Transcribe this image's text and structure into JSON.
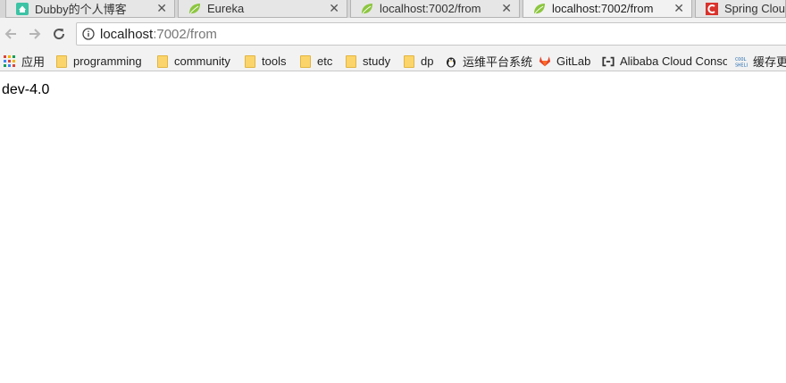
{
  "tabs": [
    {
      "title": "Dubby的个人博客",
      "icon": "house-icon",
      "active": false
    },
    {
      "title": "Eureka",
      "icon": "spring-leaf-icon",
      "active": false
    },
    {
      "title": "localhost:7002/from",
      "icon": "spring-leaf-icon",
      "active": false
    },
    {
      "title": "localhost:7002/from",
      "icon": "spring-leaf-icon",
      "active": true
    },
    {
      "title": "Spring Cloud",
      "icon": "c-logo-icon",
      "active": false
    }
  ],
  "toolbar": {
    "url_host": "localhost",
    "url_path": ":7002/from"
  },
  "bookmarks": [
    {
      "label": "应用",
      "icon": "apps-grid-icon"
    },
    {
      "label": "programming",
      "icon": "folder-icon"
    },
    {
      "label": "community",
      "icon": "folder-icon"
    },
    {
      "label": "tools",
      "icon": "folder-icon"
    },
    {
      "label": "etc",
      "icon": "folder-icon"
    },
    {
      "label": "study",
      "icon": "folder-icon"
    },
    {
      "label": "dp",
      "icon": "folder-icon"
    },
    {
      "label": "运维平台系统",
      "icon": "penguin-icon"
    },
    {
      "label": "GitLab",
      "icon": "gitlab-fox-icon"
    },
    {
      "label": "Alibaba Cloud Conso",
      "icon": "alibaba-cloud-icon"
    },
    {
      "label": "缓存更",
      "icon": "coolshell-icon"
    }
  ],
  "page": {
    "text": "dev-4.0"
  },
  "colors": {
    "tabstrip": "#d6d6d6",
    "toolbar": "#f2f2f2",
    "leaf_green": "#8cc63f",
    "folder_yellow": "#fbd56b"
  }
}
